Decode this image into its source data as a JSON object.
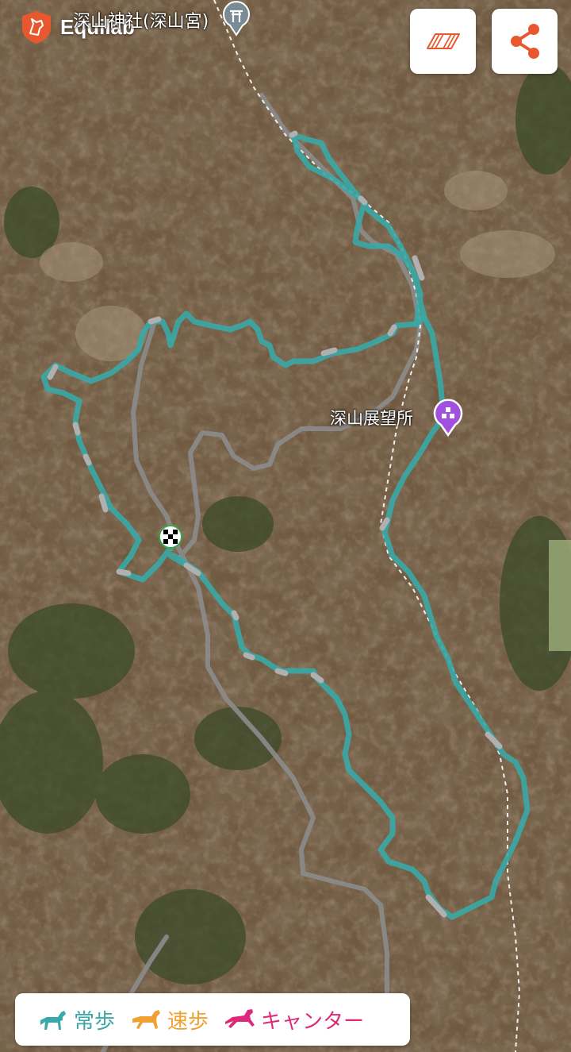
{
  "app": {
    "brand": "Equilab"
  },
  "map": {
    "shrine_label": "深山神社(深山宮)",
    "poi_label": "深山展望所",
    "colors": {
      "walk": "#3aa8a6",
      "trot": "#f0a030",
      "canter": "#e0287a",
      "gap": "#a8a8a8",
      "road": "#8a8a8a",
      "poi": "#a24fe0"
    }
  },
  "controls": {
    "layers_icon": "map-layers-icon",
    "share_icon": "share-icon"
  },
  "legend": {
    "items": [
      {
        "label": "常歩",
        "color": "#3aa8a6",
        "icon": "horse-walk-icon"
      },
      {
        "label": "速歩",
        "color": "#f0a030",
        "icon": "horse-trot-icon"
      },
      {
        "label": "キャンター",
        "color": "#e0287a",
        "icon": "horse-canter-icon"
      }
    ]
  }
}
